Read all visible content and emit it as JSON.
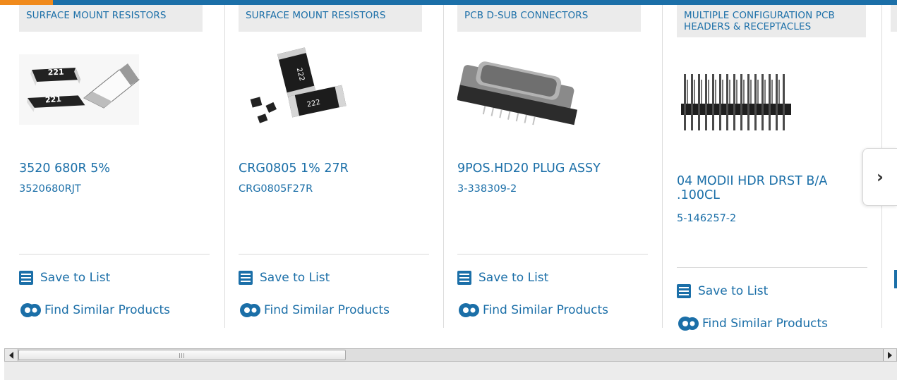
{
  "colors": {
    "link": "#1b6fa8",
    "accent": "#f08a1c",
    "category_bg": "#ebebeb"
  },
  "products": [
    {
      "category": "SURFACE MOUNT RESISTORS",
      "title": "3520 680R 5%",
      "part_number": "3520680RJT",
      "save_label": "Save to List",
      "similar_label": "Find Similar Products",
      "image": "smd-resistor-221-image"
    },
    {
      "category": "SURFACE MOUNT RESISTORS",
      "title": "CRG0805 1% 27R",
      "part_number": "CRG0805F27R",
      "save_label": "Save to List",
      "similar_label": "Find Similar Products",
      "image": "smd-resistor-222-image"
    },
    {
      "category": "PCB D-SUB CONNECTORS",
      "title": "9POS.HD20 PLUG ASSY",
      "part_number": "3-338309-2",
      "save_label": "Save to List",
      "similar_label": "Find Similar Products",
      "image": "dsub-connector-image"
    },
    {
      "category": "MULTIPLE CONFIGURATION PCB HEADERS & RECEPTACLES",
      "title": "04 MODII HDR DRST B/A .100CL",
      "part_number": "5-146257-2",
      "save_label": "Save to List",
      "similar_label": "Find Similar Products",
      "image": "pin-header-image"
    }
  ],
  "carousel": {
    "next_icon": "chevron-right-icon"
  },
  "scrollbar": {
    "left_icon": "arrow-left-icon",
    "right_icon": "arrow-right-icon"
  }
}
